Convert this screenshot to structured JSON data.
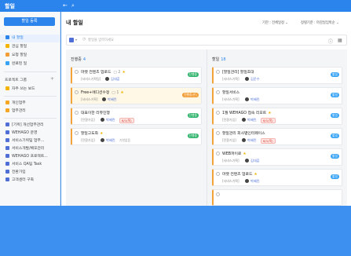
{
  "app": {
    "title": "할일"
  },
  "topbar": {
    "back_icon": "back-arrow-icon",
    "search_icon": "search-icon"
  },
  "sidebar": {
    "new_button": "할일 등록",
    "nav": [
      {
        "label": "내 할일",
        "icon": "list-icon",
        "active": true
      },
      {
        "label": "관심 할일",
        "icon": "star-icon",
        "active": false
      },
      {
        "label": "요청 할일",
        "icon": "request-icon",
        "active": false
      },
      {
        "label": "완료된 일",
        "icon": "check-icon",
        "active": false
      }
    ],
    "group_header": "프로젝트 그룹",
    "favorites": "자주 쓰는 보드",
    "projects": [
      {
        "label": "개인업무",
        "color": "#f5a623"
      },
      {
        "label": "업무관리",
        "color": "#f5a623"
      },
      {
        "label": "[기획] 개선업무관리",
        "color": "#4f6fd6"
      },
      {
        "label": "WEHAGO 운영",
        "color": "#4f6fd6"
      },
      {
        "label": "서비스기획팀 업무...",
        "color": "#4f6fd6"
      },
      {
        "label": "서비스개발/배포관리",
        "color": "#4f6fd6"
      },
      {
        "label": "WEHAGO 프로젝트...",
        "color": "#4f6fd6"
      },
      {
        "label": "서비스 QA팀 Task",
        "color": "#4f6fd6"
      },
      {
        "label": "전환가입",
        "color": "#4f6fd6"
      },
      {
        "label": "고객센터 구축",
        "color": "#4f6fd6"
      }
    ]
  },
  "main": {
    "title": "내 할일",
    "sort1": "기한 : 전체일정 ⌄",
    "sort2": "정렬기준 : 마감일임박순 ⌄",
    "filter_placeholder": "할일을 입력하세요",
    "settings_icon": "info-icon",
    "calendar_icon": "calendar-icon",
    "columns": [
      {
        "name": "진행중",
        "count": "4",
        "cards": [
          {
            "title": "마켓 컨텐츠 업로드",
            "comments": "▢ 2",
            "star": true,
            "project": "[서비스기획팀]",
            "assignee": "김대훈",
            "due": "",
            "extra": "",
            "status": "진행중",
            "status_class": "st-green",
            "highlight": false
          },
          {
            "title": "Free+에디션수정",
            "comments": "▢ 1",
            "star": true,
            "project": "[서비스기획]",
            "assignee": "박혜린",
            "due": "",
            "extra": "",
            "status": "진행중(만)",
            "status_class": "st-orange",
            "highlight": true
          },
          {
            "title": "대표이한 리뷰진행",
            "comments": "",
            "star": false,
            "project": "[전환가입]",
            "assignee": "박혜린",
            "due": "6/1(목)",
            "extra": "",
            "status": "진행중",
            "status_class": "st-green",
            "highlight": false
          },
          {
            "title": "할일고도화",
            "comments": "",
            "star": true,
            "project": "[전환가입]",
            "assignee": "박혜린",
            "due": "",
            "extra": "기한없음",
            "status": "진행중",
            "status_class": "st-green",
            "highlight": false
          }
        ]
      },
      {
        "name": "할일",
        "count": "18",
        "cards": [
          {
            "title": "[할일관리] 할일초대",
            "comments": "",
            "star": false,
            "project": "[서비스기획]",
            "assignee": "김준수",
            "due": "",
            "extra": "",
            "status": "할일",
            "status_class": "st-blue",
            "highlight": false
          },
          {
            "title": "할일서비스",
            "comments": "",
            "star": false,
            "project": "[서비스기획]",
            "assignee": "박혜린",
            "due": "",
            "extra": "",
            "status": "할일",
            "status_class": "st-blue",
            "highlight": false
          },
          {
            "title": "1월 WEHAGO 접속 리포트",
            "comments": "",
            "star": true,
            "project": "[전환가입]",
            "assignee": "박혜린",
            "due": "6/1(목)",
            "extra": "",
            "status": "할일",
            "status_class": "st-blue",
            "highlight": false
          },
          {
            "title": "할일관리 회사별인터페이스",
            "comments": "",
            "star": false,
            "project": "[전환가입]",
            "assignee": "박혜린",
            "due": "6/1(목)",
            "extra": "",
            "status": "할일",
            "status_class": "st-blue",
            "highlight": false
          },
          {
            "title": "WEB파이로",
            "comments": "",
            "star": true,
            "project": "[서비스기획]",
            "assignee": "김대훈",
            "due": "",
            "extra": "",
            "status": "할일",
            "status_class": "st-blue",
            "highlight": false
          },
          {
            "title": "마켓 컨텐츠 업로드",
            "comments": "",
            "star": true,
            "project": "[서비스기획]",
            "assignee": "박혜린",
            "due": "",
            "extra": "",
            "status": "할일",
            "status_class": "st-blue",
            "highlight": false
          }
        ]
      }
    ]
  }
}
